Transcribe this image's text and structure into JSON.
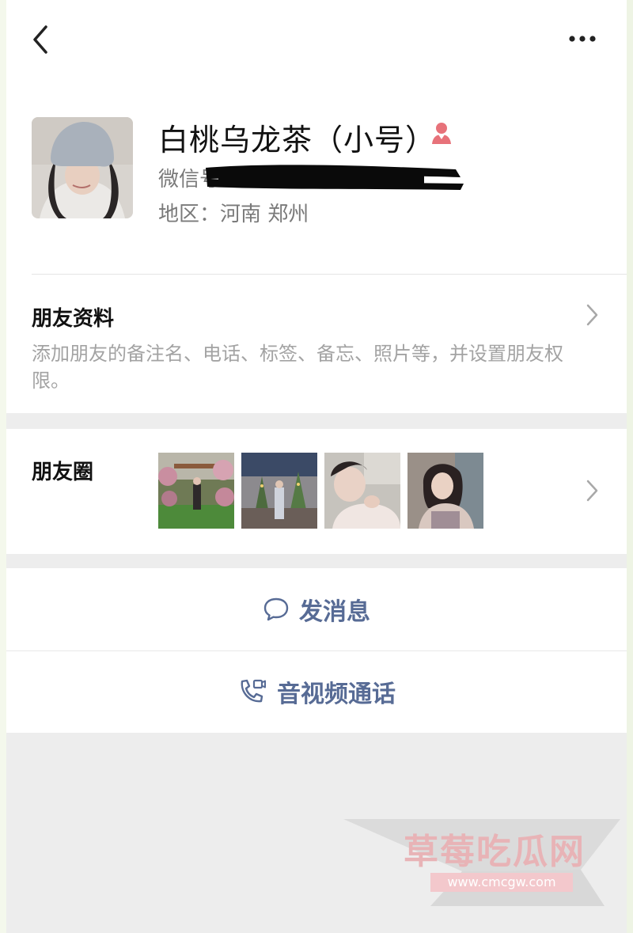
{
  "profile": {
    "name": "白桃乌龙茶（小号）",
    "wechat_id_label": "微信号",
    "region": "地区：河南 郑州"
  },
  "friend_info": {
    "title": "朋友资料",
    "description": "添加朋友的备注名、电话、标签、备忘、照片等，并设置朋友权限。"
  },
  "moments": {
    "title": "朋友圈",
    "thumbnails": [
      "garden-photo",
      "mall-photo",
      "selfie-photo",
      "portrait-photo"
    ]
  },
  "actions": {
    "message": "发消息",
    "call": "音视频通话"
  },
  "watermark": {
    "text": "草莓吃瓜网",
    "url": "www.cmcgw.com"
  },
  "colors": {
    "link": "#576b95",
    "female_badge": "#e7727a"
  }
}
